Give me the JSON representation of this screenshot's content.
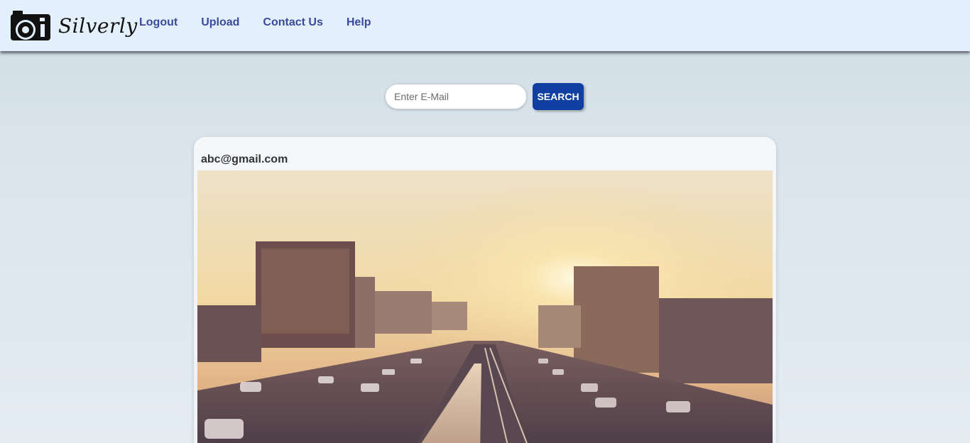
{
  "brand": {
    "name": "Silverly",
    "logo_icon": "camera-icon"
  },
  "nav": {
    "items": [
      {
        "label": "Logout"
      },
      {
        "label": "Upload"
      },
      {
        "label": "Contact Us"
      },
      {
        "label": "Help"
      }
    ]
  },
  "search": {
    "placeholder": "Enter E-Mail",
    "value": "",
    "button_label": "SEARCH"
  },
  "post": {
    "email": "abc@gmail.com",
    "image_subject": "city-sunset-photo"
  },
  "colors": {
    "navbar_bg": "#e3f0fb",
    "nav_link": "#3a4a9c",
    "search_button": "#0f3fa0",
    "page_bg": "#d8e3ea"
  }
}
